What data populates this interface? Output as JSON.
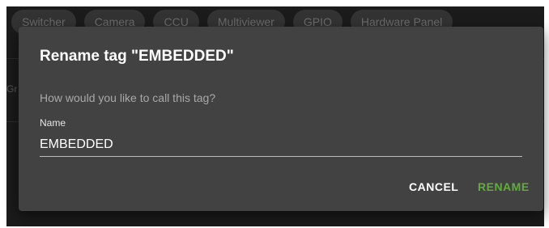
{
  "tabs": [
    {
      "label": "Switcher"
    },
    {
      "label": "Camera"
    },
    {
      "label": "CCU"
    },
    {
      "label": "Multiviewer"
    },
    {
      "label": "GPIO"
    },
    {
      "label": "Hardware Panel"
    }
  ],
  "background": {
    "partial_label": "Gr"
  },
  "dialog": {
    "title": "Rename tag \"EMBEDDED\"",
    "prompt": "How would you like to call this tag?",
    "field_label": "Name",
    "field_value": "EMBEDDED",
    "cancel_label": "CANCEL",
    "rename_label": "RENAME"
  },
  "colors": {
    "accent": "#5fae3c",
    "dialog_bg": "#424242",
    "app_bg": "#1b1b1b"
  }
}
